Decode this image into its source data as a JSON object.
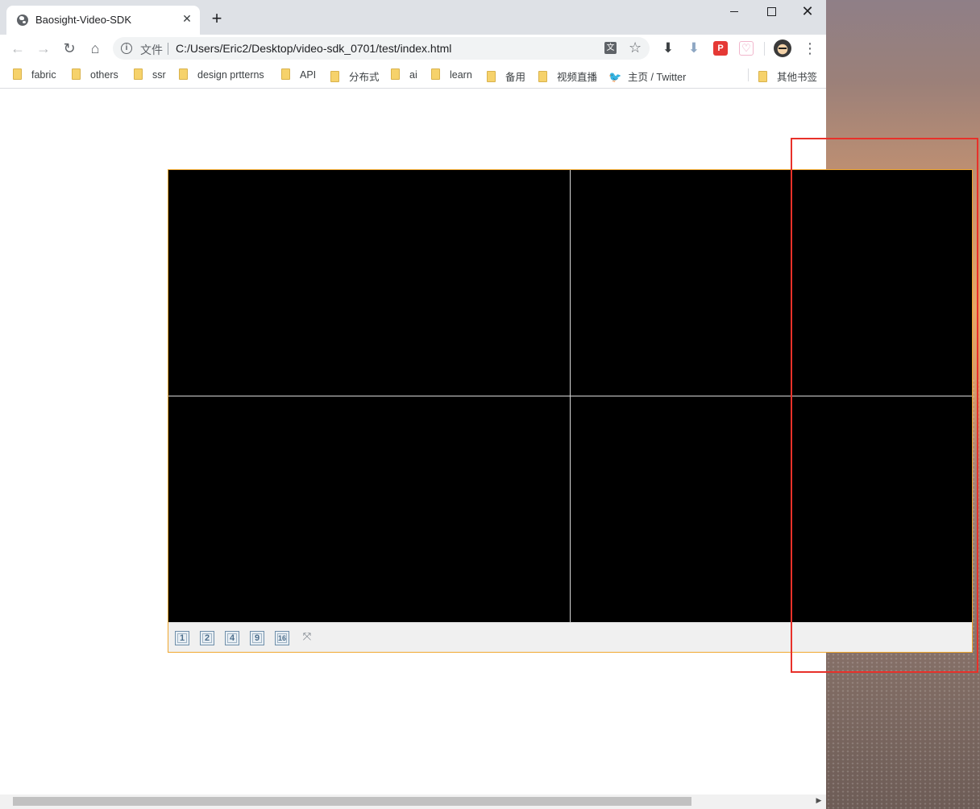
{
  "tab": {
    "title": "Baosight-Video-SDK",
    "close_glyph": "✕",
    "new_tab_glyph": "+"
  },
  "window_controls": {
    "close_glyph": "✕"
  },
  "toolbar": {
    "back_glyph": "←",
    "forward_glyph": "→",
    "reload_glyph": "↻",
    "home_glyph": "⌂",
    "scheme_label": "文件",
    "url": "C:/Users/Eric2/Desktop/video-sdk_0701/test/index.html",
    "translate_glyph": "文",
    "star_glyph": "☆",
    "download_glyph": "⬇",
    "download2_glyph": "⬇",
    "red_ext_glyph": "P",
    "pink_ext_glyph": "♡",
    "menu_glyph": "⋮"
  },
  "bookmarks": [
    {
      "label": "fabric",
      "icon": "folder-icon"
    },
    {
      "label": "others",
      "icon": "folder-icon"
    },
    {
      "label": "ssr",
      "icon": "folder-icon"
    },
    {
      "label": "design prtterns",
      "icon": "folder-icon"
    },
    {
      "label": "API",
      "icon": "folder-icon"
    },
    {
      "label": "分布式",
      "icon": "folder-icon"
    },
    {
      "label": "ai",
      "icon": "folder-icon"
    },
    {
      "label": "learn",
      "icon": "folder-icon"
    },
    {
      "label": "备用",
      "icon": "folder-icon"
    },
    {
      "label": "视频直播",
      "icon": "folder-icon"
    },
    {
      "label": "主页 / Twitter",
      "icon": "twitter-icon",
      "glyph": "🐦"
    },
    {
      "label": "其他书签",
      "icon": "folder-icon"
    }
  ],
  "player": {
    "layout_buttons": [
      "1",
      "2",
      "4",
      "9",
      "16"
    ],
    "fullscreen_glyph": "⤧"
  },
  "colors": {
    "player_border": "#f0a830",
    "highlight": "#e8312a",
    "video_bg": "#000000"
  }
}
